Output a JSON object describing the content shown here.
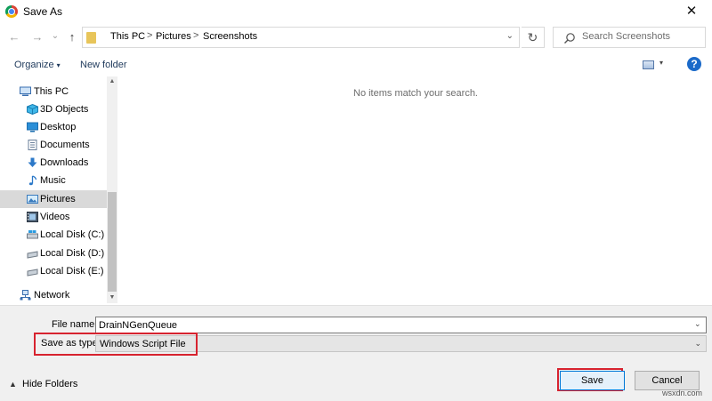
{
  "window": {
    "title": "Save As",
    "close_glyph": "✕"
  },
  "nav": {
    "back_glyph": "←",
    "forward_glyph": "→",
    "recent_glyph": "⌄",
    "up_glyph": "↑"
  },
  "address": {
    "crumbs": [
      "This PC",
      "Pictures",
      "Screenshots"
    ],
    "separator": ">",
    "dropdown_glyph": "⌄",
    "refresh_glyph": "↻"
  },
  "search": {
    "placeholder": "Search Screenshots"
  },
  "toolbar": {
    "organize": "Organize",
    "organize_caret": "▾",
    "new_folder": "New folder",
    "view_caret": "▾",
    "help": "?"
  },
  "sidebar": {
    "items": [
      {
        "label": "This PC",
        "icon": "computer-icon",
        "selected": false
      },
      {
        "label": "3D Objects",
        "icon": "3d-objects-icon",
        "selected": false
      },
      {
        "label": "Desktop",
        "icon": "desktop-icon",
        "selected": false
      },
      {
        "label": "Documents",
        "icon": "documents-icon",
        "selected": false
      },
      {
        "label": "Downloads",
        "icon": "downloads-icon",
        "selected": false
      },
      {
        "label": "Music",
        "icon": "music-icon",
        "selected": false
      },
      {
        "label": "Pictures",
        "icon": "pictures-icon",
        "selected": true
      },
      {
        "label": "Videos",
        "icon": "videos-icon",
        "selected": false
      },
      {
        "label": "Local Disk (C:)",
        "icon": "drive-icon",
        "selected": false
      },
      {
        "label": "Local Disk (D:)",
        "icon": "drive-icon",
        "selected": false
      },
      {
        "label": "Local Disk (E:)",
        "icon": "drive-icon",
        "selected": false
      },
      {
        "label": "Network",
        "icon": "network-icon",
        "selected": false
      }
    ],
    "scroll_up": "▲",
    "scroll_down": "▼"
  },
  "content": {
    "empty_message": "No items match your search."
  },
  "form": {
    "filename_label": "File name:",
    "filename_value": "DrainNGenQueue",
    "filename_drop": "⌄",
    "type_label": "Save as type:",
    "type_value": "Windows Script File",
    "type_drop": "⌄"
  },
  "footer": {
    "hide_folders": "Hide Folders",
    "hide_caret": "▲",
    "save": "Save",
    "cancel": "Cancel",
    "watermark": "wsxdn.com"
  },
  "colors": {
    "highlight": "#d7232f",
    "accent": "#0078d7",
    "link": "#1e395b",
    "selected_bg": "#d9d9d9"
  }
}
